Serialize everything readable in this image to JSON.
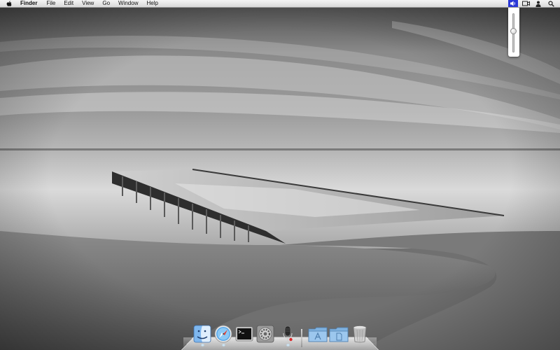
{
  "menubar": {
    "apple_icon": "apple-logo-icon",
    "app_name": "Finder",
    "items": [
      "File",
      "Edit",
      "View",
      "Go",
      "Window",
      "Help"
    ],
    "status_icons": [
      "volume-icon",
      "display-icon",
      "user-icon",
      "spotlight-search-icon"
    ],
    "active_status_icon": "volume-icon",
    "active_color": "#2a37d6"
  },
  "volume_popup": {
    "level": 0.55
  },
  "dock": {
    "items": [
      {
        "name": "finder",
        "icon": "finder-icon",
        "running": true
      },
      {
        "name": "safari",
        "icon": "safari-compass-icon",
        "running": true
      },
      {
        "name": "terminal",
        "icon": "terminal-icon",
        "running": false
      },
      {
        "name": "system-preferences",
        "icon": "system-preferences-icon",
        "running": false
      },
      {
        "name": "voice-memo",
        "icon": "microphone-icon",
        "running": true
      }
    ],
    "stacks": [
      {
        "name": "applications",
        "icon": "applications-folder-icon"
      },
      {
        "name": "documents",
        "icon": "documents-folder-icon"
      }
    ],
    "trash": {
      "icon": "trash-icon"
    }
  }
}
